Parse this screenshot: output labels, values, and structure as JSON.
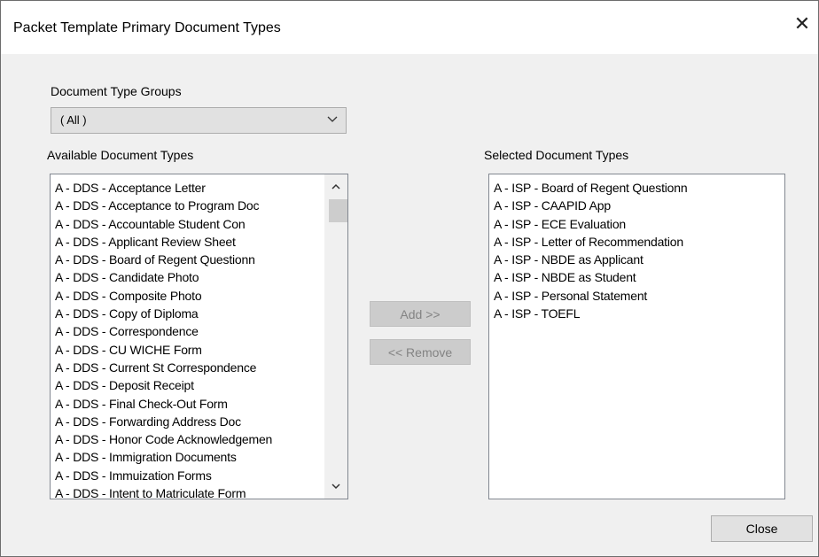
{
  "window": {
    "title": "Packet Template Primary Document Types",
    "close_glyph": "✕"
  },
  "groups": {
    "label": "Document Type Groups",
    "selected": "( All )"
  },
  "available": {
    "label": "Available Document Types",
    "items": [
      "A - DDS - Acceptance Letter",
      "A - DDS - Acceptance to Program Doc",
      "A - DDS - Accountable Student Con",
      "A - DDS - Applicant Review Sheet",
      "A - DDS - Board of Regent Questionn",
      "A - DDS - Candidate Photo",
      "A - DDS - Composite Photo",
      "A - DDS - Copy of Diploma",
      "A - DDS - Correspondence",
      "A - DDS - CU WICHE Form",
      "A - DDS - Current St Correspondence",
      "A - DDS - Deposit Receipt",
      "A - DDS - Final Check-Out Form",
      "A - DDS - Forwarding Address Doc",
      "A - DDS - Honor Code Acknowledgemen",
      "A - DDS - Immigration Documents",
      "A - DDS - Immuization Forms",
      "A - DDS - Intent to Matriculate Form"
    ]
  },
  "selected": {
    "label": "Selected Document Types",
    "items": [
      "A - ISP - Board of Regent Questionn",
      "A - ISP - CAAPID App",
      "A - ISP - ECE Evaluation",
      "A - ISP - Letter of Recommendation",
      "A - ISP - NBDE as Applicant",
      "A - ISP - NBDE as Student",
      "A - ISP - Personal Statement",
      "A - ISP - TOEFL"
    ]
  },
  "buttons": {
    "add": "Add >>",
    "remove": "<< Remove",
    "close": "Close"
  },
  "icons": {
    "dropdown": "chevron-down-icon",
    "scroll_up": "chevron-up-icon",
    "scroll_down": "chevron-down-icon",
    "window_close": "close-icon"
  },
  "colors": {
    "dialog_bg": "#f0f0f0",
    "disabled_button_bg": "#cccccc",
    "disabled_text": "#838383"
  }
}
